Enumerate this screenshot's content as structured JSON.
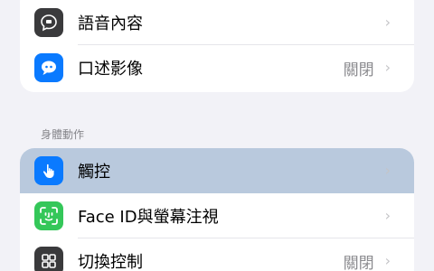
{
  "section_header": "身體動作",
  "top_rows": [
    {
      "label": "語音內容",
      "value": "",
      "icon": "speech-bubble-icon"
    },
    {
      "label": "口述影像",
      "value": "關閉",
      "icon": "message-quote-icon"
    }
  ],
  "bottom_rows": [
    {
      "label": "觸控",
      "value": "",
      "icon": "hand-touch-icon"
    },
    {
      "label": "Face ID與螢幕注視",
      "value": "",
      "icon": "face-id-icon"
    },
    {
      "label": "切換控制",
      "value": "關閉",
      "icon": "switch-control-icon"
    }
  ],
  "chevron": "›",
  "colors": {
    "background": "#f2f2f7",
    "highlight": "#b9c9dd",
    "blue": "#0a7aff",
    "green": "#34c759",
    "dark": "#3a3a3c"
  }
}
